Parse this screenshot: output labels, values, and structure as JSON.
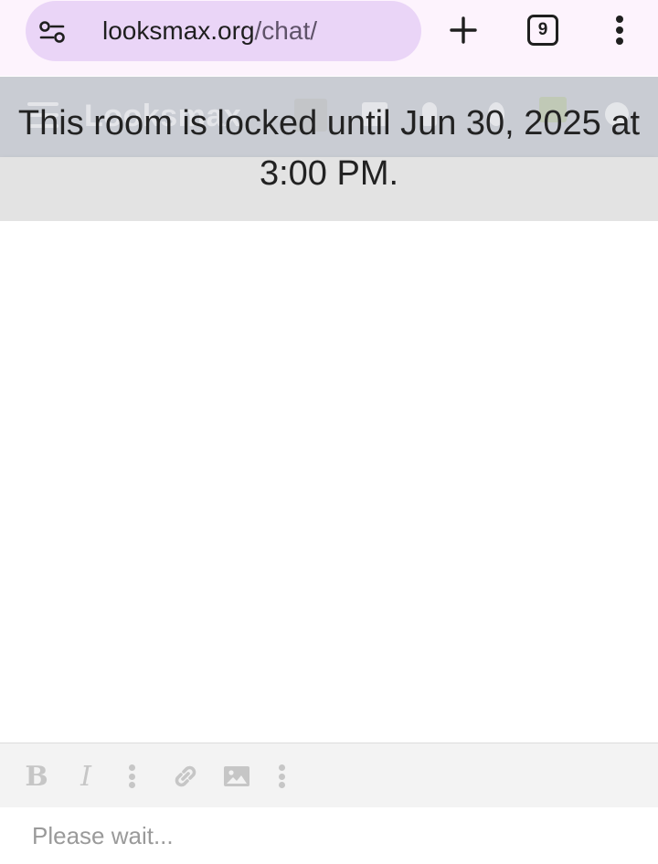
{
  "browser": {
    "url_domain": "looksmax.org",
    "url_path": "/chat/",
    "tab_count": "9",
    "icons": {
      "site_info": "tune-icon",
      "new_tab": "plus-icon",
      "menu": "more-vert-icon"
    }
  },
  "site_header": {
    "logo_text": "Looksmax"
  },
  "chat": {
    "lock_message": "This room is locked until Jun 30, 2025 at 3:00 PM."
  },
  "editor": {
    "bold_label": "B",
    "italic_label": "I",
    "icons": [
      "bold-icon",
      "italic-icon",
      "more-options-icon",
      "link-icon",
      "image-icon",
      "more-options-icon"
    ],
    "placeholder": "Please wait..."
  },
  "colors": {
    "url_pill": "#ead5f7",
    "browser_bg": "#fdf3fd",
    "banner": "#c9ccd3",
    "toolbar_icon": "#c6c6c6"
  }
}
